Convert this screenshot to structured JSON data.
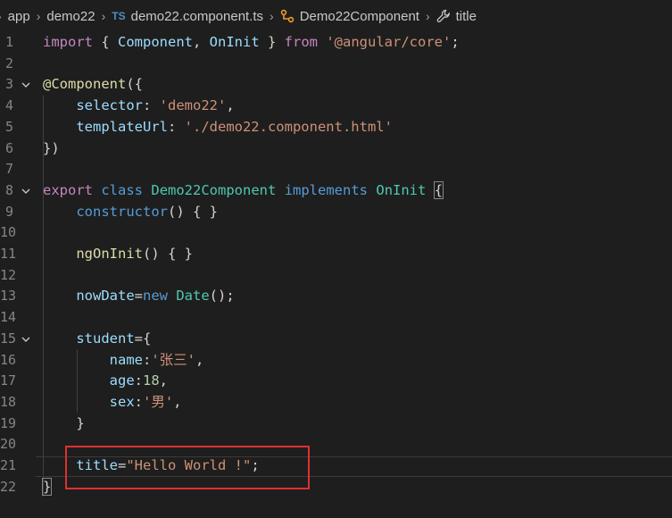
{
  "breadcrumb": [
    {
      "label": "app"
    },
    {
      "label": "demo22"
    },
    {
      "label": "demo22.component.ts",
      "tag": "TS"
    },
    {
      "label": "Demo22Component"
    },
    {
      "label": "title"
    }
  ],
  "lines": [
    {
      "n": "1",
      "tokens": [
        [
          "kc",
          "import"
        ],
        [
          "pun",
          " { "
        ],
        [
          "prop",
          "Component"
        ],
        [
          "pun",
          ", "
        ],
        [
          "prop",
          "OnInit"
        ],
        [
          "pun",
          " } "
        ],
        [
          "kc",
          "from"
        ],
        [
          "pun",
          " "
        ],
        [
          "str",
          "'@angular/core'"
        ],
        [
          "pun",
          ";"
        ]
      ]
    },
    {
      "n": "2",
      "tokens": []
    },
    {
      "n": "3",
      "fold": true,
      "tokens": [
        [
          "dec",
          "@Component"
        ],
        [
          "pun",
          "({"
        ]
      ]
    },
    {
      "n": "4",
      "tokens": [
        [
          "pun",
          "    "
        ],
        [
          "prop",
          "selector"
        ],
        [
          "pun",
          ": "
        ],
        [
          "str",
          "'demo22'"
        ],
        [
          "pun",
          ","
        ]
      ]
    },
    {
      "n": "5",
      "tokens": [
        [
          "pun",
          "    "
        ],
        [
          "prop",
          "templateUrl"
        ],
        [
          "pun",
          ": "
        ],
        [
          "str",
          "'./demo22.component.html'"
        ]
      ]
    },
    {
      "n": "6",
      "tokens": [
        [
          "pun",
          "})"
        ]
      ]
    },
    {
      "n": "7",
      "tokens": []
    },
    {
      "n": "8",
      "fold": true,
      "tokens": [
        [
          "kc",
          "export"
        ],
        [
          "pun",
          " "
        ],
        [
          "kw",
          "class"
        ],
        [
          "pun",
          " "
        ],
        [
          "cls",
          "Demo22Component"
        ],
        [
          "pun",
          " "
        ],
        [
          "kw",
          "implements"
        ],
        [
          "pun",
          " "
        ],
        [
          "cls",
          "OnInit"
        ],
        [
          "pun",
          " "
        ],
        [
          "hl",
          "{"
        ]
      ]
    },
    {
      "n": "9",
      "tokens": [
        [
          "pun",
          "    "
        ],
        [
          "kw",
          "constructor"
        ],
        [
          "pun",
          "() { }"
        ]
      ]
    },
    {
      "n": "10",
      "tokens": []
    },
    {
      "n": "11",
      "tokens": [
        [
          "pun",
          "    "
        ],
        [
          "fn",
          "ngOnInit"
        ],
        [
          "pun",
          "() { }"
        ]
      ]
    },
    {
      "n": "12",
      "tokens": []
    },
    {
      "n": "13",
      "tokens": [
        [
          "pun",
          "    "
        ],
        [
          "prop",
          "nowDate"
        ],
        [
          "pun",
          "="
        ],
        [
          "kw",
          "new"
        ],
        [
          "pun",
          " "
        ],
        [
          "cls",
          "Date"
        ],
        [
          "pun",
          "();"
        ]
      ]
    },
    {
      "n": "14",
      "tokens": []
    },
    {
      "n": "15",
      "fold": true,
      "tokens": [
        [
          "pun",
          "    "
        ],
        [
          "prop",
          "student"
        ],
        [
          "pun",
          "={"
        ]
      ]
    },
    {
      "n": "16",
      "tokens": [
        [
          "pun",
          "        "
        ],
        [
          "prop",
          "name"
        ],
        [
          "pun",
          ":"
        ],
        [
          "str",
          "'张三'"
        ],
        [
          "pun",
          ","
        ]
      ]
    },
    {
      "n": "17",
      "tokens": [
        [
          "pun",
          "        "
        ],
        [
          "prop",
          "age"
        ],
        [
          "pun",
          ":"
        ],
        [
          "num",
          "18"
        ],
        [
          "pun",
          ","
        ]
      ]
    },
    {
      "n": "18",
      "tokens": [
        [
          "pun",
          "        "
        ],
        [
          "prop",
          "sex"
        ],
        [
          "pun",
          ":"
        ],
        [
          "str",
          "'男'"
        ],
        [
          "pun",
          ","
        ]
      ]
    },
    {
      "n": "19",
      "tokens": [
        [
          "pun",
          "    }"
        ]
      ]
    },
    {
      "n": "20",
      "tokens": []
    },
    {
      "n": "21",
      "current": true,
      "tokens": [
        [
          "pun",
          "    "
        ],
        [
          "prop",
          "title"
        ],
        [
          "pun",
          "="
        ],
        [
          "str",
          "\"Hello World !\""
        ],
        [
          "pun",
          ";"
        ]
      ]
    },
    {
      "n": "22",
      "tokens": [
        [
          "hl",
          "}"
        ]
      ]
    }
  ]
}
